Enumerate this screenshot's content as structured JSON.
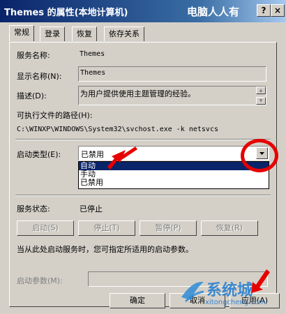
{
  "window": {
    "title": "Themes 的属性(本地计算机)",
    "watermark_top": "电脑人人有",
    "help_label": "?",
    "close_label": "×"
  },
  "tabs": [
    {
      "label": "常规",
      "active": true
    },
    {
      "label": "登录",
      "active": false
    },
    {
      "label": "恢复",
      "active": false
    },
    {
      "label": "依存关系",
      "active": false
    }
  ],
  "fields": {
    "service_name_label": "服务名称:",
    "service_name_value": "Themes",
    "display_name_label": "显示名称(N):",
    "display_name_value": "Themes",
    "description_label": "描述(D):",
    "description_value": "为用户提供使用主题管理的经验。",
    "path_label": "可执行文件的路径(H):",
    "path_value": "C:\\WINXP\\WINDOWS\\System32\\svchost.exe -k netsvcs",
    "startup_type_label": "启动类型(E):",
    "startup_type_value": "已禁用",
    "startup_options": [
      "自动",
      "手动",
      "已禁用"
    ],
    "service_status_label": "服务状态:",
    "service_status_value": "已停止"
  },
  "service_buttons": {
    "start": "启动(S)",
    "stop": "停止(T)",
    "pause": "暂停(P)",
    "resume": "恢复(R)"
  },
  "hint_text": "当从此处启动服务时，您可指定所适用的启动参数。",
  "start_params_label": "启动参数(M):",
  "footer_buttons": {
    "ok": "确定",
    "cancel": "取消",
    "apply": "应用(A)"
  },
  "watermark_bottom": {
    "brand": "系统城",
    "url": "xitongcheng.com"
  },
  "colors": {
    "title_bar": "#0a246a",
    "selection": "#0a246a",
    "annotation_red": "#e60000"
  }
}
